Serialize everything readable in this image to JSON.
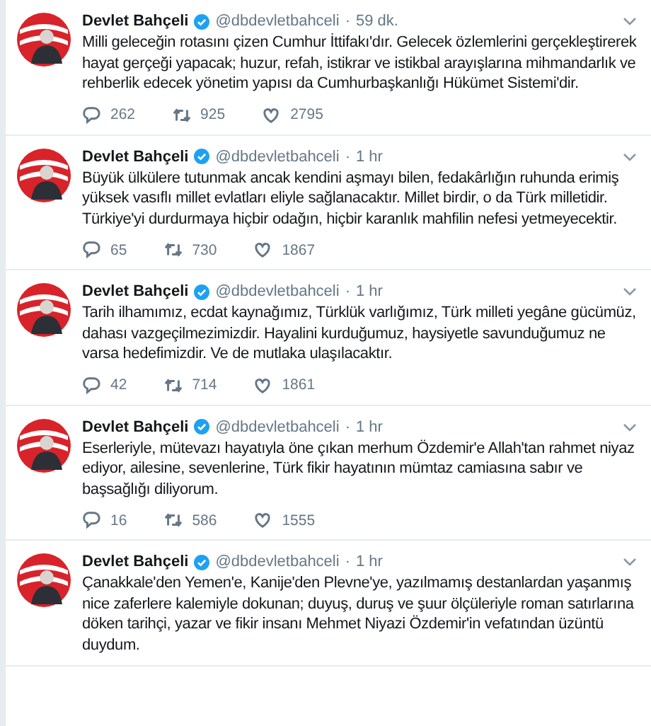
{
  "tweets": [
    {
      "name": "Devlet Bahçeli",
      "verified": true,
      "handle": "@dbdevletbahceli",
      "separator": "·",
      "time": "59 dk.",
      "text": "Milli geleceğin rotasını çizen Cumhur İttifakı'dır. Gelecek özlemlerini gerçekleştirerek hayat gerçeği yapacak; huzur, refah, istikrar ve istikbal arayışlarına mihmandarlık ve rehberlik edecek yönetim yapısı da Cumhurbaşkanlığı Hükümet Sistemi'dir.",
      "replies": "262",
      "retweets": "925",
      "likes": "2795"
    },
    {
      "name": "Devlet Bahçeli",
      "verified": true,
      "handle": "@dbdevletbahceli",
      "separator": "·",
      "time": "1 hr",
      "text": "Büyük ülkülere tutunmak ancak kendini aşmayı bilen, fedakârlığın ruhunda erimiş yüksek vasıflı millet evlatları eliyle sağlanacaktır. Millet birdir, o da Türk milletidir. Türkiye'yi durdurmaya hiçbir odağın, hiçbir karanlık mahfilin nefesi yetmeyecektir.",
      "replies": "65",
      "retweets": "730",
      "likes": "1867"
    },
    {
      "name": "Devlet Bahçeli",
      "verified": true,
      "handle": "@dbdevletbahceli",
      "separator": "·",
      "time": "1 hr",
      "text": "Tarih ilhamımız, ecdat kaynağımız, Türklük varlığımız, Türk milleti yegâne gücümüz, dahası vazgeçilmezimizdir. Hayalini kurduğumuz, haysiyetle savunduğumuz ne varsa hedefimizdir. Ve de mutlaka ulaşılacaktır.",
      "replies": "42",
      "retweets": "714",
      "likes": "1861"
    },
    {
      "name": "Devlet Bahçeli",
      "verified": true,
      "handle": "@dbdevletbahceli",
      "separator": "·",
      "time": "1 hr",
      "text": "Eserleriyle, mütevazı hayatıyla öne çıkan merhum Özdemir'e Allah'tan rahmet niyaz ediyor, ailesine, sevenlerine, Türk fikir hayatının mümtaz camiasına sabır ve başsağlığı diliyorum.",
      "replies": "16",
      "retweets": "586",
      "likes": "1555"
    },
    {
      "name": "Devlet Bahçeli",
      "verified": true,
      "handle": "@dbdevletbahceli",
      "separator": "·",
      "time": "1 hr",
      "text": "Çanakkale'den Yemen'e, Kanije'den Plevne'ye, yazılmamış destanlardan yaşanmış nice zaferlere kalemiyle dokunan; duyuş, duruş ve şuur ölçüleriyle roman satırlarına döken tarihçi, yazar ve fikir insanı Mehmet Niyazi Özdemir'in vefatından üzüntü duydum."
    }
  ]
}
